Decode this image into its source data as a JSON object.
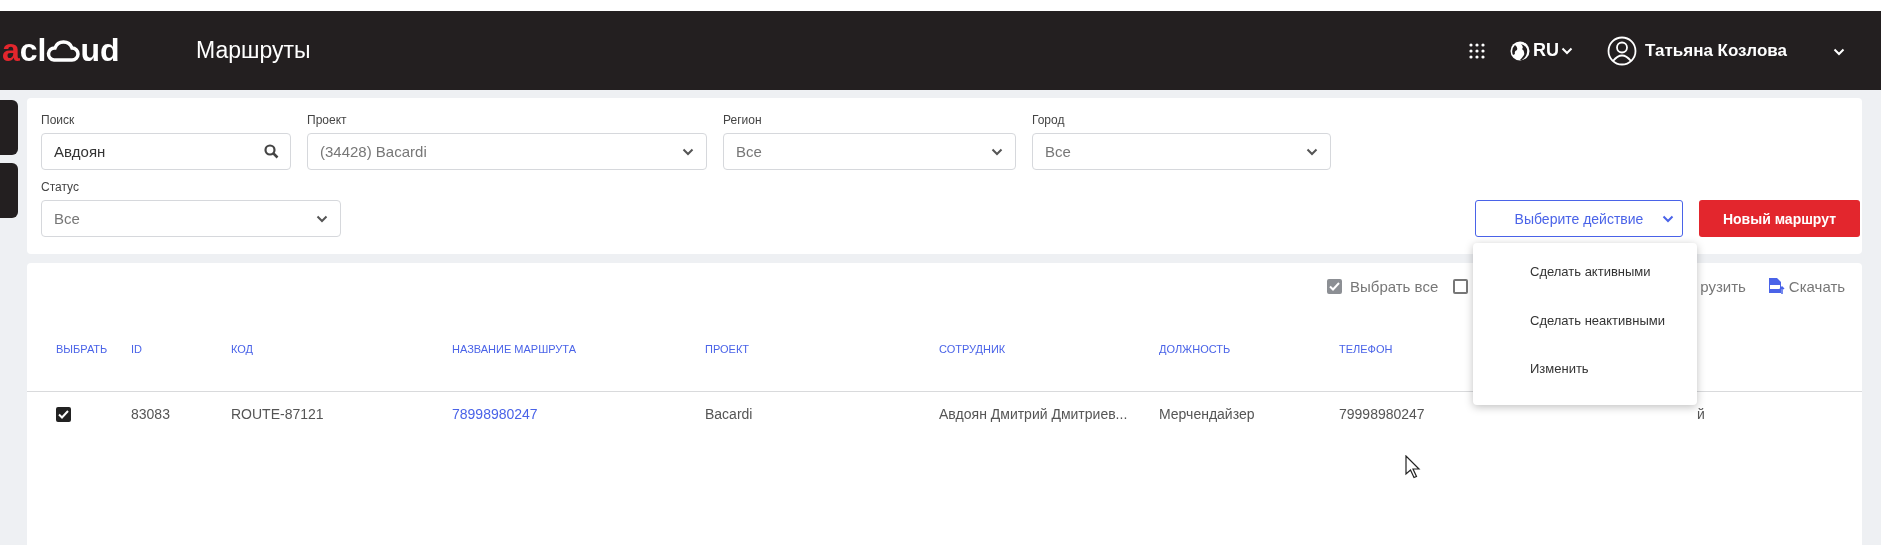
{
  "logo": {
    "accent": "a",
    "before": "cl",
    "after": "ud"
  },
  "header": {
    "title": "Маршруты",
    "language": "RU",
    "user": "Татьяна Козлова"
  },
  "filters": [
    {
      "kind": "search",
      "label": "Поиск",
      "value": "Авдоян"
    },
    {
      "kind": "select",
      "label": "Проект",
      "value": "(34428) Bacardi"
    },
    {
      "kind": "select",
      "label": "Регион",
      "value": "Все"
    },
    {
      "kind": "select",
      "label": "Город",
      "value": "Все"
    }
  ],
  "status_filter": {
    "label": "Статус",
    "value": "Все"
  },
  "action_select": {
    "placeholder": "Выберите действие",
    "expanded": true,
    "options": [
      "Сделать активными",
      "Сделать неактивными",
      "Изменить"
    ]
  },
  "new_button": "Новый маршрут",
  "toolbar": {
    "select_all": {
      "label": "Выбрать все",
      "checked": true
    },
    "second_checkbox": {
      "checked": false
    },
    "upload_label": "рузить",
    "download_label": "Скачать"
  },
  "table": {
    "select_header": "ВЫБРАТЬ",
    "columns": [
      "ID",
      "КОД",
      "НАЗВАНИЕ МАРШРУТА",
      "ПРОЕКТ",
      "СОТРУДНИК",
      "ДОЛЖНОСТЬ",
      "ТЕЛЕФОН"
    ],
    "rows": [
      {
        "selected": true,
        "cells": [
          "83083",
          "ROUTE-87121",
          "78998980247",
          "Bacardi",
          "Авдоян Дмитрий Дмитриев...",
          "Мерчендайзер",
          "79998980247",
          "й"
        ]
      }
    ]
  }
}
